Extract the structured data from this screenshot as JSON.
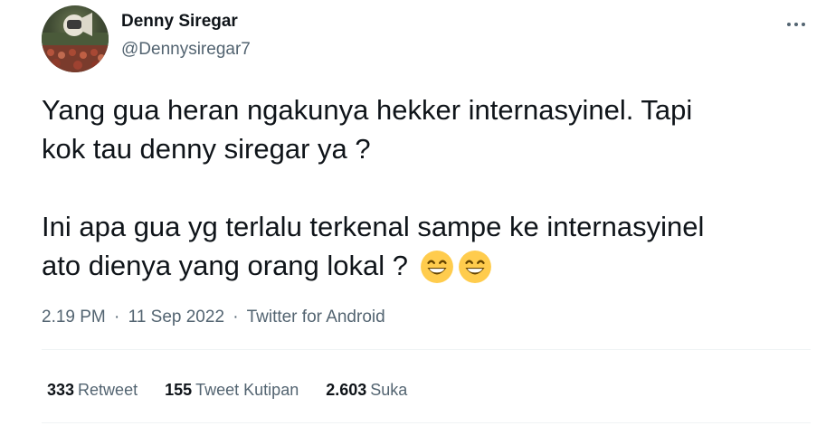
{
  "author": {
    "name": "Denny Siregar",
    "handle": "@Dennysiregar7"
  },
  "tweet": {
    "paragraph1_line1": "Yang gua heran ngakunya hekker internasyinel. Tapi",
    "paragraph1_line2": "kok tau denny siregar ya ?",
    "paragraph2_line1": "Ini apa gua yg terlalu terkenal sampe ke internasyinel",
    "paragraph2_line2": "ato dienya yang orang lokal ?",
    "emoji": "grinning-face-with-smiling-eyes"
  },
  "meta": {
    "time": "2.19 PM",
    "separator": "·",
    "date": "11 Sep 2022",
    "source": "Twitter for Android"
  },
  "stats": {
    "retweets_count": "333",
    "retweets_label": "Retweet",
    "quotes_count": "155",
    "quotes_label": "Tweet Kutipan",
    "likes_count": "2.603",
    "likes_label": "Suka"
  },
  "colors": {
    "text_primary": "#0f1419",
    "text_secondary": "#536471",
    "divider": "#eff3f4",
    "emoji_face": "#ffcc4d"
  }
}
